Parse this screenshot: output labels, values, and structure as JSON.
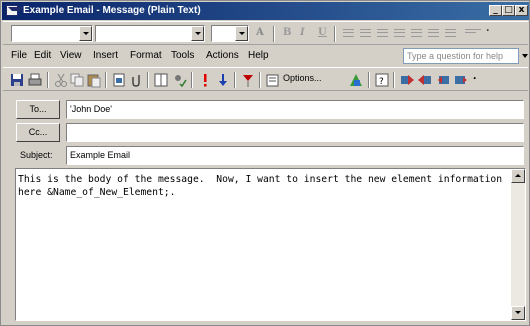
{
  "window": {
    "title": "Example Email - Message (Plain Text)"
  },
  "menu": {
    "items": [
      "File",
      "Edit",
      "View",
      "Insert",
      "Format",
      "Tools",
      "Actions",
      "Help"
    ]
  },
  "help_box": {
    "placeholder": "Type a question for help"
  },
  "toolbar": {
    "options_label": "Options...",
    "icons": [
      "save-icon",
      "print-icon",
      "cut-icon",
      "copy-icon",
      "paste-icon",
      "insert-file-icon",
      "attach-icon",
      "address-book-icon",
      "check-names-icon",
      "high-importance-icon",
      "low-importance-icon",
      "follow-up-flag-icon",
      "options-icon",
      "permission-icon",
      "help-icon",
      "send-icon",
      "reply-icon",
      "reply-all-icon",
      "forward-icon"
    ]
  },
  "format_toolbar": {
    "font_name": "",
    "font_size": "",
    "glyphs": [
      "A",
      "B",
      "I",
      "U"
    ]
  },
  "header": {
    "to_button": "To...",
    "to_value": "'John Doe'",
    "cc_button": "Cc...",
    "cc_value": "",
    "subject_label": "Subject:",
    "subject_value": "Example Email"
  },
  "body": {
    "text": "This is the body of the message.  Now, I want to insert the new element information here &Name_of_New_Element;."
  },
  "colors": {
    "title_start": "#0a246a",
    "title_end": "#3a6ea5",
    "chrome": "#d4d0c8"
  }
}
